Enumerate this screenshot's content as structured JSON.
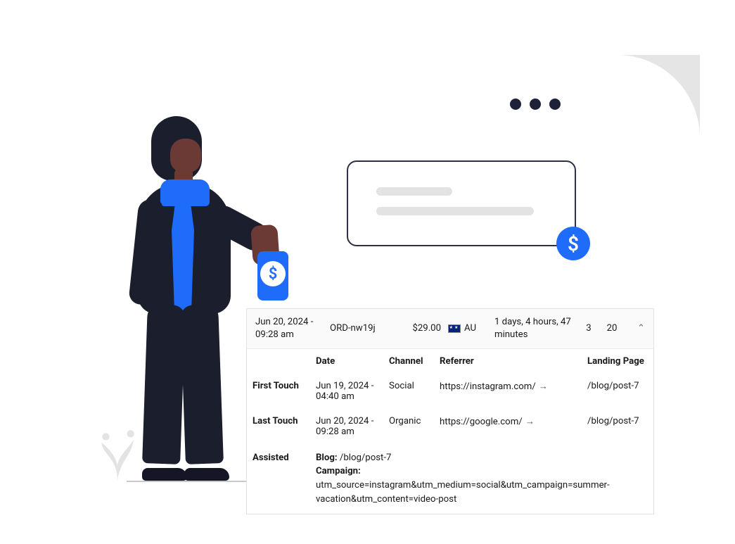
{
  "window": {
    "dollar_badge": "$"
  },
  "phone": {
    "dollar": "$"
  },
  "order": {
    "date": "Jun 20, 2024 - 09:28 am",
    "id": "ORD-nw19j",
    "amount": "$29.00",
    "country_code": "AU",
    "duration": "1 days, 4 hours, 47 minutes",
    "count_a": "3",
    "count_b": "20",
    "expand_icon": "⌃"
  },
  "table": {
    "headers": {
      "date": "Date",
      "channel": "Channel",
      "referrer": "Referrer",
      "landing": "Landing Page"
    },
    "first_touch": {
      "label": "First Touch",
      "date": "Jun 19, 2024 - 04:40 am",
      "channel": "Social",
      "referrer": "https://instagram.com/",
      "landing": "/blog/post-7"
    },
    "last_touch": {
      "label": "Last Touch",
      "date": "Jun 20, 2024 - 09:28 am",
      "channel": "Organic",
      "referrer": "https://google.com/",
      "landing": "/blog/post-7"
    },
    "assisted": {
      "label": "Assisted",
      "blog_label": "Blog:",
      "blog_value": "/blog/post-7",
      "campaign_label": "Campaign:",
      "campaign_value": "utm_source=instagram&utm_medium=social&utm_campaign=summer-vacation&utm_content=video-post"
    },
    "arrow": "→"
  }
}
